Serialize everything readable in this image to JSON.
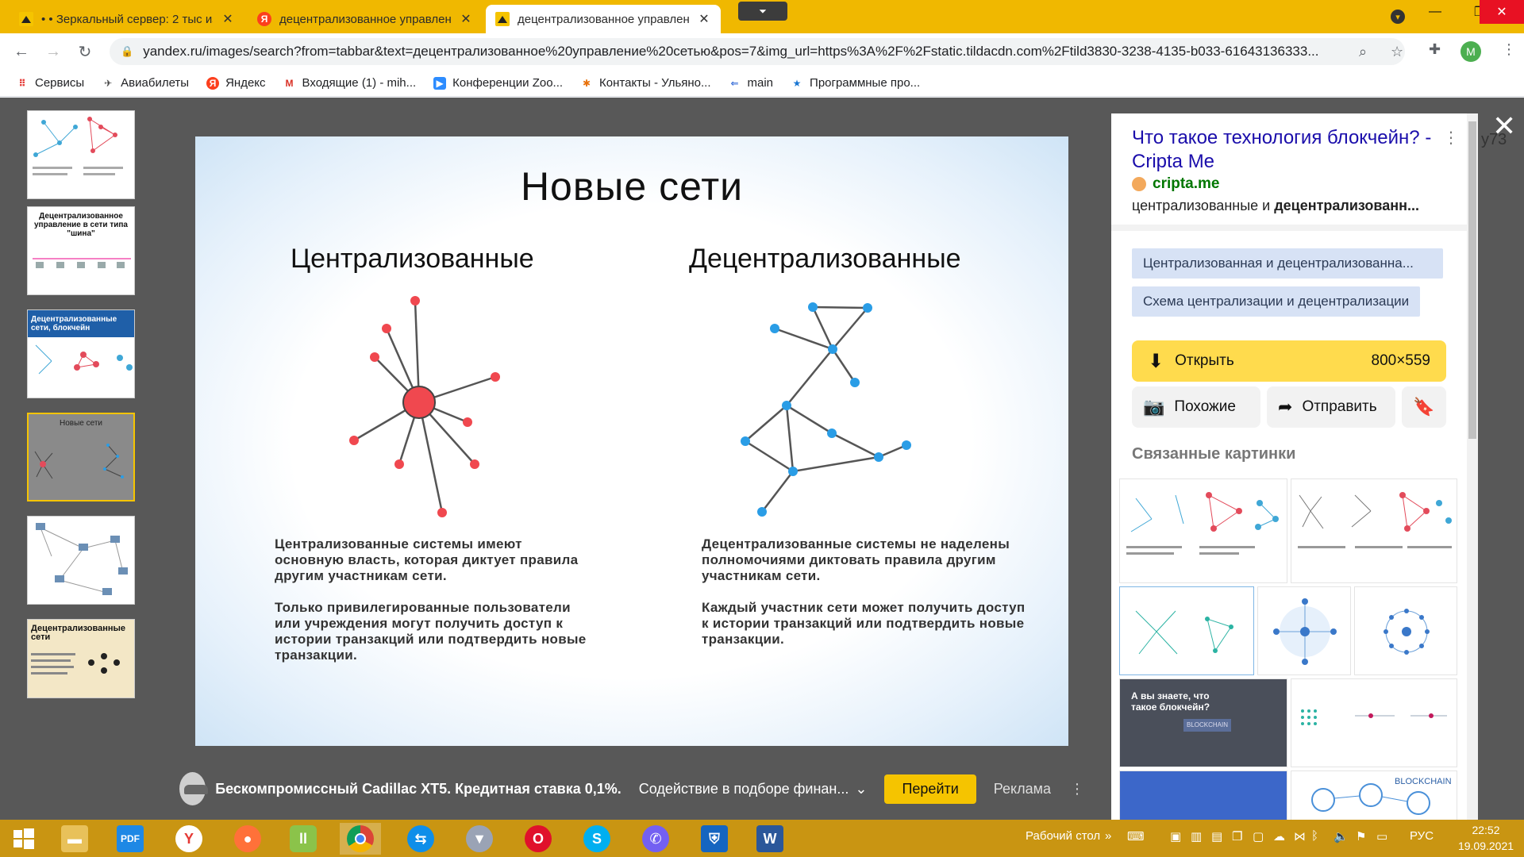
{
  "browser": {
    "tabs": [
      {
        "title": "• • Зеркальный сервер: 2 тыс из",
        "icon": "image-search-icon",
        "active": false
      },
      {
        "title": "децентрализованное управлени",
        "icon": "yandex-icon",
        "active": false
      },
      {
        "title": "децентрализованное управлени",
        "icon": "image-search-icon",
        "active": true
      }
    ],
    "window": {
      "minimize": "—",
      "maximize": "❐",
      "close": "✕"
    },
    "url": "yandex.ru/images/search?from=tabbar&text=децентрализованное%20управление%20сетью&pos=7&img_url=https%3A%2F%2Fstatic.tildacdn.com%2Ftild3830-3238-4135-b033-61643136333...",
    "avatar_letter": "M",
    "bookmarks": [
      {
        "label": "Сервисы",
        "icon": "apps-grid-icon"
      },
      {
        "label": "Авиабилеты",
        "icon": "plane-icon"
      },
      {
        "label": "Яндекс",
        "icon": "yandex-icon"
      },
      {
        "label": "Входящие (1) - mih...",
        "icon": "gmail-icon"
      },
      {
        "label": "Конференции Zoo...",
        "icon": "zoom-icon"
      },
      {
        "label": "Контакты - Ульяно...",
        "icon": "bitrix-icon"
      },
      {
        "label": "main",
        "icon": "link-icon"
      },
      {
        "label": "Программные про...",
        "icon": "star-icon"
      }
    ]
  },
  "thumbnails": [
    {
      "label": ""
    },
    {
      "label": "Децентрализованное управление в сети типа \"шина\""
    },
    {
      "label": "Децентрализованные сети, блокчейн"
    },
    {
      "label": "Новые сети"
    },
    {
      "label": ""
    },
    {
      "label": "Децентрализованные сети"
    }
  ],
  "slide": {
    "title": "Новые сети",
    "left": {
      "heading": "Централизованные",
      "para1": "Централизованные системы имеют основную власть, которая диктует правила другим участникам сети.",
      "para2": "Только привилегированные пользователи или учреждения могут получить доступ к истории транзакций или подтвердить новые транзакции."
    },
    "right": {
      "heading": "Децентрализованные",
      "para1": "Децентрализованные системы не наделены полномочиями диктовать правила другим участникам сети.",
      "para2": "Каждый участник сети может получить доступ к истории транзакций или подтвердить новые транзакции."
    },
    "colors": {
      "central": "#f0484f",
      "decentral": "#2a9de6"
    }
  },
  "ad": {
    "title": "Бескомпромиссный Cadillac XT5. Кредитная ставка 0,1%.",
    "subtitle": "Содействие в подборе финан...",
    "button": "Перейти",
    "label": "Реклама"
  },
  "panel": {
    "title": "Что такое технология блокчейн? - Cripta Me",
    "site": "cripta.me",
    "snippet_prefix": "централизованные и ",
    "snippet_bold": "децентрализованн...",
    "chips": [
      "Централизованная и децентрализованна...",
      "Схема централизации и децентрализации"
    ],
    "open_label": "Открыть",
    "resolution": "800×559",
    "similar_label": "Похожие",
    "send_label": "Отправить",
    "related_heading": "Связанные картинки",
    "related_texts": [
      "А вы знаете, что такое блокчейн?",
      "BLOCKCHAIN"
    ],
    "side_fragment": "у73"
  },
  "taskbar": {
    "desktop_label": "Рабочий стол",
    "lang": "РУС",
    "time": "22:52",
    "date": "19.09.2021"
  }
}
